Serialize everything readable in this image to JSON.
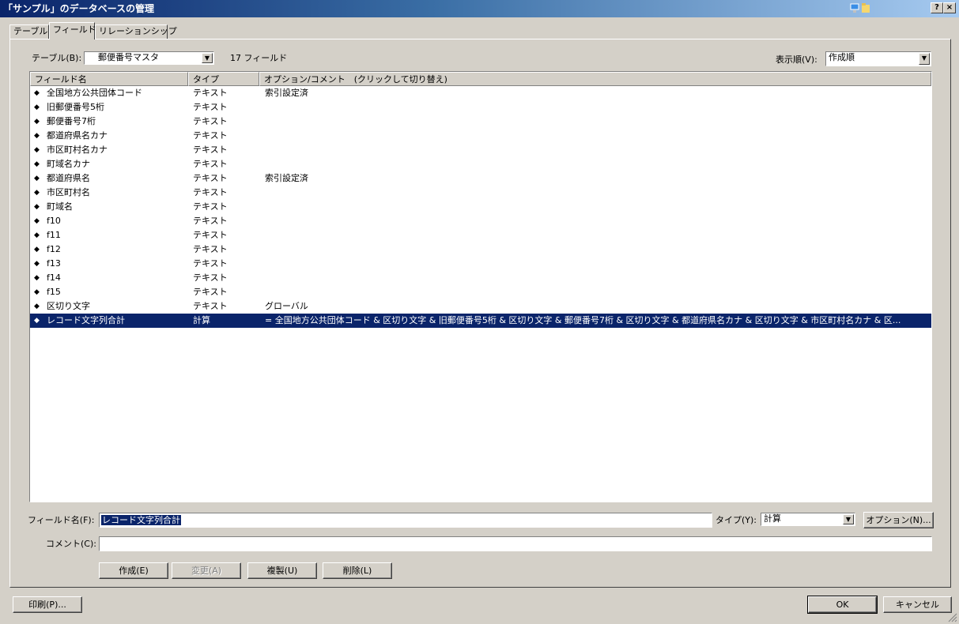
{
  "window": {
    "title": "「サンプル」のデータベースの管理",
    "help_button": "?",
    "close_button": "×"
  },
  "tabs": [
    {
      "label": "テーブル"
    },
    {
      "label": "フィールド"
    },
    {
      "label": "リレーションシップ"
    }
  ],
  "table_selector": {
    "label": "テーブル(B):",
    "value": "郵便番号マスタ",
    "field_count": "17 フィールド"
  },
  "sort_selector": {
    "label": "表示順(V):",
    "value": "作成順"
  },
  "list": {
    "columns": [
      "フィールド名",
      "タイプ",
      "オプション/コメント　(クリックして切り替え)"
    ],
    "rows": [
      {
        "name": "全国地方公共団体コード",
        "type": "テキスト",
        "option": "索引設定済"
      },
      {
        "name": "旧郵便番号5桁",
        "type": "テキスト",
        "option": ""
      },
      {
        "name": "郵便番号7桁",
        "type": "テキスト",
        "option": ""
      },
      {
        "name": "都道府県名カナ",
        "type": "テキスト",
        "option": ""
      },
      {
        "name": "市区町村名カナ",
        "type": "テキスト",
        "option": ""
      },
      {
        "name": "町域名カナ",
        "type": "テキスト",
        "option": ""
      },
      {
        "name": "都道府県名",
        "type": "テキスト",
        "option": "索引設定済"
      },
      {
        "name": "市区町村名",
        "type": "テキスト",
        "option": ""
      },
      {
        "name": "町域名",
        "type": "テキスト",
        "option": ""
      },
      {
        "name": "f10",
        "type": "テキスト",
        "option": ""
      },
      {
        "name": "f11",
        "type": "テキスト",
        "option": ""
      },
      {
        "name": "f12",
        "type": "テキスト",
        "option": ""
      },
      {
        "name": "f13",
        "type": "テキスト",
        "option": ""
      },
      {
        "name": "f14",
        "type": "テキスト",
        "option": ""
      },
      {
        "name": "f15",
        "type": "テキスト",
        "option": ""
      },
      {
        "name": "区切り文字",
        "type": "テキスト",
        "option": "グローバル"
      },
      {
        "name": "レコード文字列合計",
        "type": "計算",
        "option": "= 全国地方公共団体コード & 区切り文字 & 旧郵便番号5桁 & 区切り文字 & 郵便番号7桁 & 区切り文字 & 都道府県名カナ & 区切り文字 & 市区町村名カナ & 区...",
        "selected": true
      }
    ]
  },
  "editor": {
    "field_name_label": "フィールド名(F):",
    "field_name_value": "レコード文字列合計",
    "type_label": "タイプ(Y):",
    "type_value": "計算",
    "options_button": "オプション(N)...",
    "comment_label": "コメント(C):",
    "comment_value": ""
  },
  "actions": {
    "create": "作成(E)",
    "change": "変更(A)",
    "duplicate": "複製(U)",
    "delete": "削除(L)"
  },
  "footer": {
    "print": "印刷(P)...",
    "ok": "OK",
    "cancel": "キャンセル"
  },
  "colors": {
    "selection": "#0a246a",
    "face": "#d4d0c8"
  }
}
